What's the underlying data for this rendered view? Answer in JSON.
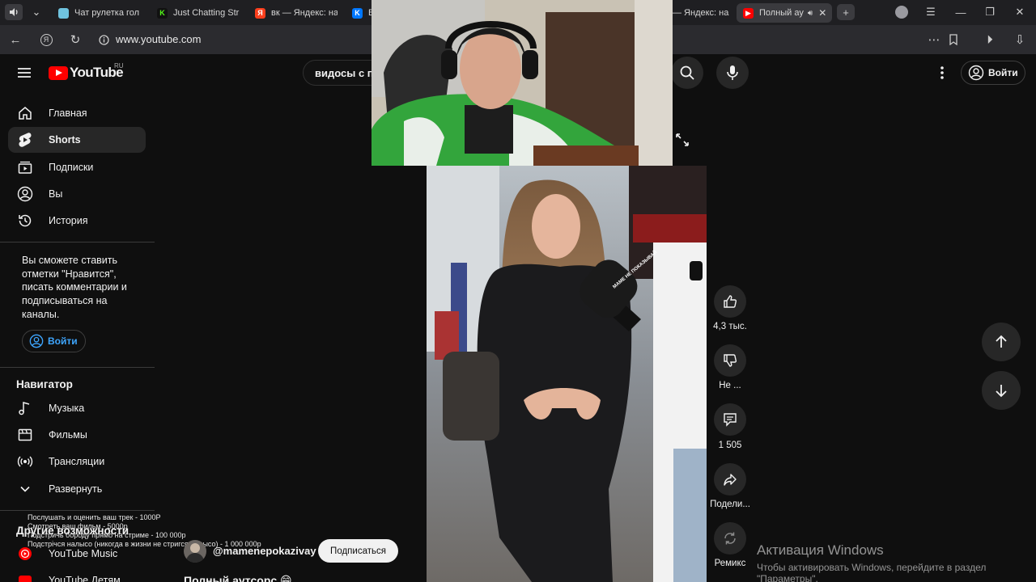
{
  "browser": {
    "tabs": [
      {
        "label": "Чат рулетка гол",
        "icon": "twitch-style-icon",
        "color": "#6fc3df"
      },
      {
        "label": "Just Chatting Str",
        "icon": "kick-icon",
        "color": "#53fc18"
      },
      {
        "label": "вк — Яндекс: на",
        "icon": "yandex-icon",
        "color": "#fc3f1d"
      },
      {
        "label": "В",
        "icon": "vk-icon",
        "color": "#0077ff"
      },
      {
        "label": "— Яндекс: на",
        "icon": "yandex-icon",
        "color": "#fc3f1d"
      },
      {
        "label": "Полный ау",
        "icon": "youtube-icon",
        "color": "#ff0000"
      }
    ],
    "url": "www.youtube.com"
  },
  "youtube": {
    "logo_text": "YouTube",
    "region": "RU",
    "search_query": "видосы с п",
    "login_label": "Войти"
  },
  "sidebar": {
    "items": [
      {
        "label": "Главная",
        "icon": "home-icon"
      },
      {
        "label": "Shorts",
        "icon": "shorts-icon"
      },
      {
        "label": "Подписки",
        "icon": "subscriptions-icon"
      },
      {
        "label": "Вы",
        "icon": "you-icon"
      },
      {
        "label": "История",
        "icon": "history-icon"
      }
    ],
    "login_note": "Вы сможете ставить отметки \"Нравится\", писать комментарии и подписываться на каналы.",
    "login_label": "Войти",
    "navigator_title": "Навигатор",
    "navigator_items": [
      {
        "label": "Музыка",
        "icon": "music-icon"
      },
      {
        "label": "Фильмы",
        "icon": "film-icon"
      },
      {
        "label": "Трансляции",
        "icon": "live-icon"
      },
      {
        "label": "Развернуть",
        "icon": "chevron-down-icon"
      }
    ],
    "more_title": "Другие возможности",
    "more_items": [
      {
        "label": "YouTube Music",
        "icon": "youtube-music-icon"
      },
      {
        "label": "YouTube Детям",
        "icon": "youtube-kids-icon"
      }
    ]
  },
  "stream_overlay": {
    "lines": [
      "Послушать и оценить ваш трек - 1000Р",
      "Смотреть ваш фильм - 5000р",
      "Подстричь бороду прямо на стриме - 100 000р",
      "Подстрічся налысо (никогда в жизни не стригся налысо) - 1 000 000р"
    ]
  },
  "short": {
    "channel": "@mamenepokazivay",
    "subscribe_label": "Подписаться",
    "title": "Полный аутсорс 😁",
    "mic_text": "МАМЕ НЕ ПОКАЗЫВАЙ",
    "likes": "4,3 тыс.",
    "dislike_label": "Не ...",
    "comments": "1 505",
    "share_label": "Подели...",
    "remix_label": "Ремикс"
  },
  "windows_watermark": {
    "title": "Активация Windows",
    "line1": "Чтобы активировать Windows, перейдите в раздел",
    "line2": "\"Параметры\"."
  }
}
